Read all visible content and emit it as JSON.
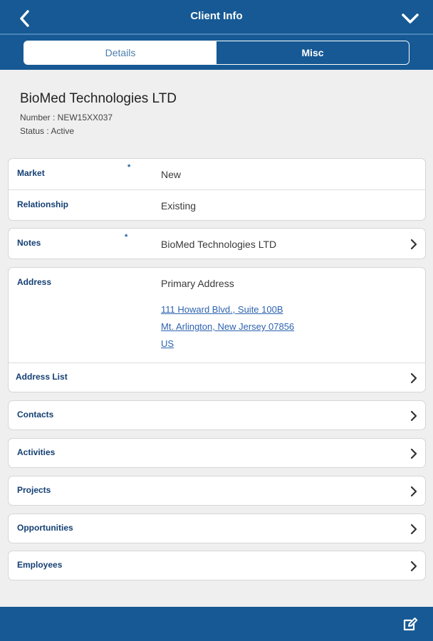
{
  "topbar": {
    "title": "Client Info",
    "back_icon": "chevron-left-icon",
    "collapse_icon": "chevron-down-icon"
  },
  "tabs": [
    {
      "label": "Details",
      "active": true
    },
    {
      "label": "Misc",
      "active": false
    }
  ],
  "client": {
    "name": "BioMed Technologies LTD",
    "number": "Number : NEW15XX037",
    "status": "Status : Active"
  },
  "fields": {
    "market": {
      "label": "Market",
      "value": "New",
      "required_mark": "*"
    },
    "relationship": {
      "label": "Relationship",
      "value": "Existing"
    },
    "notes": {
      "label": "Notes",
      "value": "BioMed Technologies LTD",
      "required_mark": "*"
    },
    "address": {
      "label": "Address",
      "title": "Primary Address",
      "line1": "111 Howard Blvd., Suite 100B",
      "line2": "Mt. Arlington, New Jersey 07856",
      "line3": "US"
    },
    "address_list": {
      "label": "Address List"
    }
  },
  "nav": [
    {
      "label": "Contacts"
    },
    {
      "label": "Activities"
    },
    {
      "label": "Projects"
    },
    {
      "label": "Opportunities"
    },
    {
      "label": "Employees"
    }
  ],
  "colors": {
    "primary": "#165994",
    "label": "#143f73",
    "link": "#2d63b0",
    "background": "#efefef"
  },
  "bottombar": {
    "edit_icon": "edit-icon"
  }
}
